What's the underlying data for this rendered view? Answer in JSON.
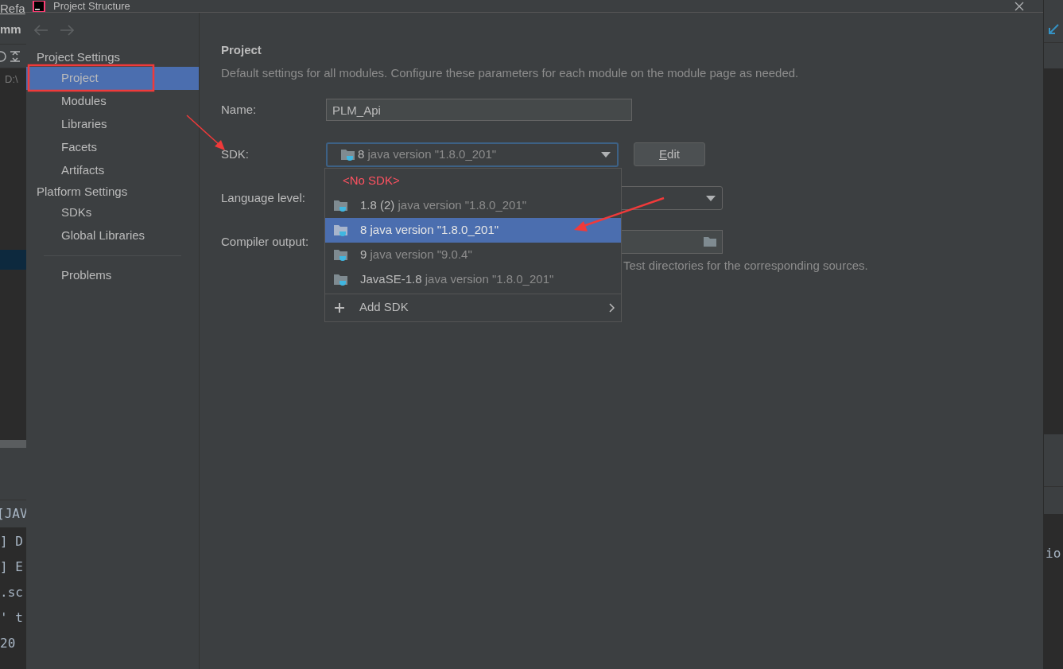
{
  "window": {
    "title": "Project Structure"
  },
  "background_ide": {
    "menu_text": "Refa",
    "tab_text": "mm",
    "path_text": "D:\\",
    "console_header": "[JAV",
    "console_lines": [
      "] D",
      "] E",
      ".sc",
      "' t",
      "20"
    ],
    "right_console_line": "io"
  },
  "sidebar": {
    "sections": [
      {
        "heading": "Project Settings",
        "items": [
          {
            "label": "Project",
            "selected": true
          },
          {
            "label": "Modules",
            "selected": false
          },
          {
            "label": "Libraries",
            "selected": false
          },
          {
            "label": "Facets",
            "selected": false
          },
          {
            "label": "Artifacts",
            "selected": false
          }
        ]
      },
      {
        "heading": "Platform Settings",
        "items": [
          {
            "label": "SDKs",
            "selected": false
          },
          {
            "label": "Global Libraries",
            "selected": false
          }
        ]
      }
    ],
    "bottom_items": [
      {
        "label": "Problems",
        "selected": false
      }
    ]
  },
  "content": {
    "title": "Project",
    "description": "Default settings for all modules. Configure these parameters for each module on the module page as needed.",
    "name": {
      "label": "Name:",
      "value": "PLM_Api"
    },
    "sdk": {
      "label": "SDK:",
      "value_name": "8",
      "value_detail": "java version \"1.8.0_201\"",
      "edit_button": "Edit"
    },
    "sdk_menu": {
      "items": [
        {
          "kind": "none",
          "name": "<No SDK>",
          "selected": false
        },
        {
          "kind": "sdk",
          "name": "1.8 (2)",
          "detail": "java version \"1.8.0_201\"",
          "selected": false
        },
        {
          "kind": "sdk",
          "name": "8",
          "detail": "java version \"1.8.0_201\"",
          "selected": true
        },
        {
          "kind": "sdk",
          "name": "9",
          "detail": "java version \"9.0.4\"",
          "selected": false
        },
        {
          "kind": "sdk",
          "name": "JavaSE-1.8",
          "detail": "java version \"1.8.0_201\"",
          "selected": false
        }
      ],
      "add_label": "Add SDK"
    },
    "language_level": {
      "label": "Language level:"
    },
    "compiler_output": {
      "label": "Compiler output:",
      "note": "Test directories for the corresponding sources."
    }
  }
}
